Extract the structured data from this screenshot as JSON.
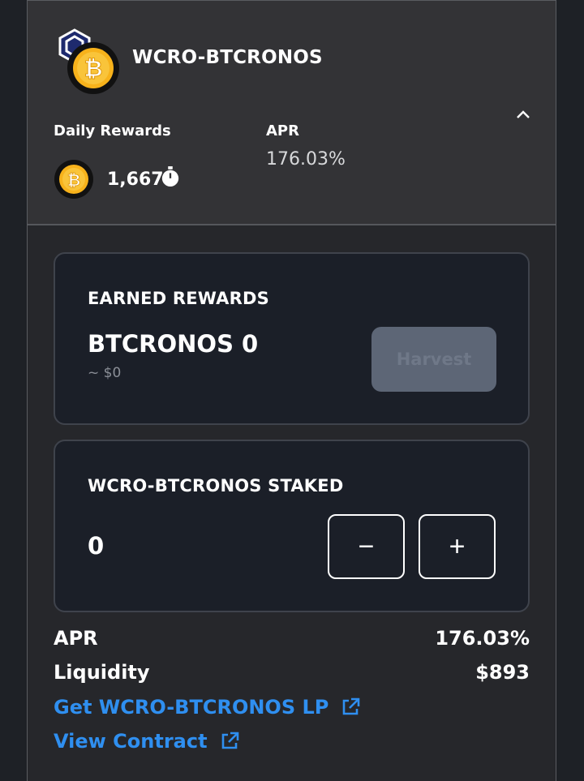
{
  "header": {
    "pair_title": "WCRO-BTCRONOS",
    "daily_rewards_label": "Daily Rewards",
    "daily_rewards_value": "1,667",
    "apr_label": "APR",
    "apr_value": "176.03%",
    "icons": [
      "cronos-logo-icon",
      "bitcoin-icon",
      "stopwatch-icon",
      "chevron-up-icon"
    ]
  },
  "earned": {
    "label": "EARNED REWARDS",
    "amount": "BTCRONOS 0",
    "usd": "~ $0",
    "harvest_label": "Harvest"
  },
  "staked": {
    "label": "WCRO-BTCRONOS STAKED",
    "amount": "0",
    "minus_label": "−",
    "plus_label": "+"
  },
  "details": {
    "apr_label": "APR",
    "apr_value": "176.03%",
    "liquidity_label": "Liquidity",
    "liquidity_value": "$893",
    "get_lp_link": "Get WCRO-BTCRONOS LP",
    "view_contract_link": "View Contract"
  },
  "colors": {
    "background": "#1e2126",
    "header_bg": "#333336",
    "panel_bg": "#1b1f28",
    "link": "#2f8ff0",
    "harvest_disabled_bg": "#5d6676",
    "bitcoin": "#f7b21b"
  }
}
